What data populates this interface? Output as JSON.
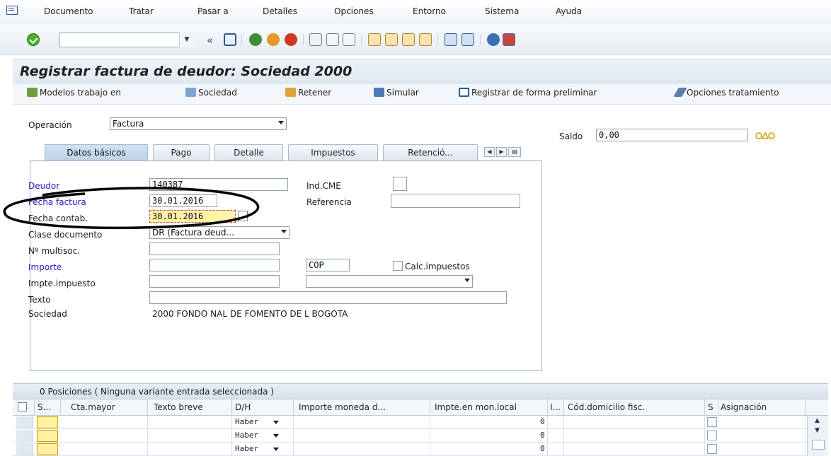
{
  "menu": {
    "items": [
      "Documento",
      "Tratar",
      "Pasar a",
      "Detalles",
      "Opciones",
      "Entorno",
      "Sistema",
      "Ayuda"
    ]
  },
  "toolbar": {
    "command_value": "",
    "back_glyph": "«"
  },
  "page": {
    "title": "Registrar factura de deudor: Sociedad 2000"
  },
  "app_toolbar": {
    "models": "Modelos trabajo en",
    "company": "Sociedad",
    "hold": "Retener",
    "simulate": "Simular",
    "park": "Registrar de forma preliminar",
    "options": "Opciones tratamiento"
  },
  "header": {
    "operation_label": "Operación",
    "operation_value": "Factura",
    "balance_label": "Saldo",
    "balance_value": "0,00",
    "balance_icon": "traffic-light-icon"
  },
  "tabs": [
    "Datos básicos",
    "Pago",
    "Detalle",
    "Impuestos",
    "Retenció..."
  ],
  "form": {
    "debtor_label": "Deudor",
    "debtor_value": "140387",
    "invoice_date_label": "Fecha factura",
    "invoice_date_value": "30.01.2016",
    "posting_date_label": "Fecha contab.",
    "posting_date_value": "30.01.2016",
    "doc_class_label": "Clase documento",
    "doc_class_value": "DR (Factura deud...",
    "multisoc_label": "Nº multisoc.",
    "multisoc_value": "",
    "amount_label": "Importe",
    "amount_value": "",
    "currency_value": "COP",
    "calc_tax_label": "Calc.impuestos",
    "tax_amount_label": "Impte.impuesto",
    "tax_amount_value": "",
    "tax_code_value": "",
    "text_label": "Texto",
    "text_value": "",
    "company_label": "Sociedad",
    "company_value": "2000 FONDO NAL DE FOMENTO DE L BOGOTA",
    "cme_label": "Ind.CME",
    "reference_label": "Referencia",
    "reference_value": ""
  },
  "grid": {
    "header": "0 Posiciones ( Ninguna variante entrada seleccionada )",
    "columns": [
      "S...",
      "Cta.mayor",
      "Texto breve",
      "D/H",
      "Importe moneda d...",
      "Impte.en mon.local",
      "I...",
      "Cód.domicilio fisc.",
      "S",
      "Asignación"
    ],
    "rows": [
      {
        "dh": "Haber",
        "local": "0"
      },
      {
        "dh": "Haber",
        "local": "0"
      },
      {
        "dh": "Haber",
        "local": "0"
      }
    ]
  },
  "colors": {
    "title_bg": "#dfe8f2",
    "tab_active": "#bdd2ea",
    "highlight_field": "#fff3a8",
    "required_label": "#2222bb",
    "annotation_circle": "#000000"
  }
}
